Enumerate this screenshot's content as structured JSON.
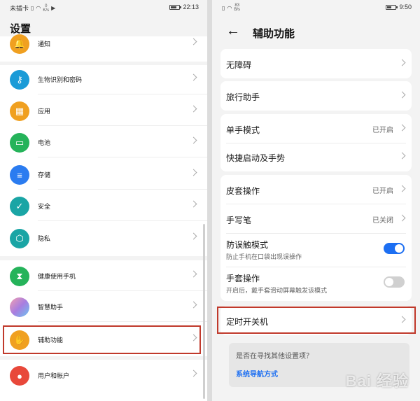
{
  "left": {
    "status": {
      "carrier": "未插卡",
      "speed_top": "0",
      "speed_bottom": "K/s",
      "time": "22:13"
    },
    "title": "设置",
    "items": [
      {
        "label": "通知",
        "icon": "bell-icon",
        "color": "#f0a020"
      },
      {
        "label": "生物识别和密码",
        "icon": "key-icon",
        "color": "#1a9bd7"
      },
      {
        "label": "应用",
        "icon": "apps-grid-icon",
        "color": "#f0a020"
      },
      {
        "label": "电池",
        "icon": "battery-icon",
        "color": "#25b35a"
      },
      {
        "label": "存储",
        "icon": "storage-icon",
        "color": "#2b7cf0"
      },
      {
        "label": "安全",
        "icon": "shield-icon",
        "color": "#1aa5a5"
      },
      {
        "label": "隐私",
        "icon": "privacy-icon",
        "color": "#1aa5a5"
      },
      {
        "label": "健康使用手机",
        "icon": "hourglass-icon",
        "color": "#25b35a"
      },
      {
        "label": "智慧助手",
        "icon": "assistant-icon",
        "color": "#a87de0"
      },
      {
        "label": "辅助功能",
        "icon": "hand-icon",
        "color": "#f0a020"
      },
      {
        "label": "用户和帐户",
        "icon": "user-icon",
        "color": "#e8483a"
      }
    ]
  },
  "right": {
    "status": {
      "speed_top": "83",
      "speed_bottom": "B/s",
      "time": "9:50"
    },
    "title": "辅助功能",
    "rows": [
      {
        "label": "无障碍",
        "value": ""
      },
      {
        "label": "旅行助手",
        "value": ""
      },
      {
        "label": "单手模式",
        "value": "已开启"
      },
      {
        "label": "快捷启动及手势",
        "value": ""
      },
      {
        "label": "皮套操作",
        "value": "已开启"
      },
      {
        "label": "手写笔",
        "value": "已关闭"
      },
      {
        "label": "防误触模式",
        "sub": "防止手机在口袋出现误操作",
        "toggle": "on"
      },
      {
        "label": "手套操作",
        "sub": "开启后，戴手套滑动屏幕触发该模式",
        "toggle": "off"
      },
      {
        "label": "定时开关机",
        "value": ""
      }
    ],
    "suggest": {
      "question": "是否在寻找其他设置项？",
      "link": "系统导航方式"
    },
    "watermark": "Bai 经验"
  }
}
